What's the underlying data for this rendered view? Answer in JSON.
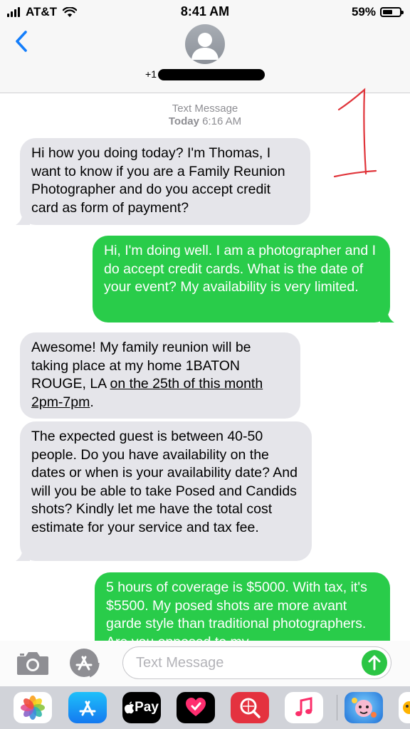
{
  "status_bar": {
    "carrier": "AT&T",
    "time": "8:41 AM",
    "battery": "59%",
    "battery_level": 0.59
  },
  "header": {
    "back_icon": "chevron-left-icon",
    "contact_prefix": "+1",
    "avatar_icon": "person-silhouette-icon"
  },
  "annotation": {
    "mark": "1"
  },
  "thread": {
    "timestamp_label": "Text Message",
    "timestamp_day": "Today",
    "timestamp_time": "6:16 AM",
    "messages": [
      {
        "direction": "incoming",
        "text": "Hi how you doing today? I'm Thomas, I want to know if you are a Family Reunion Photographer and do you accept credit card as form of payment?"
      },
      {
        "direction": "outgoing",
        "text": "Hi, I'm doing well. I am a photographer and I do accept credit cards. What is the date of your event? My availability is very limited."
      },
      {
        "direction": "incoming",
        "text_plain": "Awesome! My family reunion will be taking place at my home 1BATON ROUGE, LA ",
        "text_link": "on the 25th of this month 2pm-7pm",
        "text_end": "."
      },
      {
        "direction": "incoming",
        "text": "The expected guest is between 40-50 people. Do you have availability on the dates or when is your availability date? And will you be able to take Posed and Candids shots? Kindly let me have the total cost estimate for your service and tax fee."
      },
      {
        "direction": "outgoing",
        "text": "5 hours of coverage is $5000. With tax, it's $5500. My posed shots are more avant garde style than traditional photographers. Are you opposed to my"
      }
    ]
  },
  "input_bar": {
    "placeholder": "Text Message",
    "camera_icon": "camera-icon",
    "apps_icon": "app-store-icon",
    "send_icon": "send-arrow-icon"
  },
  "app_drawer": {
    "apps": [
      {
        "name": "photos-icon"
      },
      {
        "name": "app-store-icon"
      },
      {
        "name": "apple-pay-icon",
        "label": "Pay"
      },
      {
        "name": "digital-touch-icon"
      },
      {
        "name": "images-search-icon"
      },
      {
        "name": "music-icon"
      },
      {
        "name": "animoji-icon"
      }
    ]
  },
  "colors": {
    "outgoing_bubble": "#29cc4a",
    "incoming_bubble": "#e5e5ea",
    "link_blue": "#147efb",
    "annotation_red": "#e0343a"
  }
}
